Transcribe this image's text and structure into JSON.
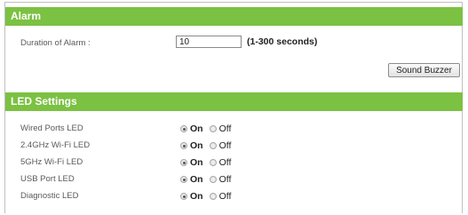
{
  "alarm": {
    "header": "Alarm",
    "duration_label": "Duration of Alarm :",
    "duration_value": "10",
    "duration_hint": "(1-300 seconds)",
    "sound_buzzer_label": "Sound Buzzer"
  },
  "led": {
    "header": "LED Settings",
    "on_label": "On",
    "off_label": "Off",
    "rows": [
      {
        "label": "Wired Ports LED",
        "selected": "On"
      },
      {
        "label": "2.4GHz Wi-Fi LED",
        "selected": "On"
      },
      {
        "label": "5GHz Wi-Fi LED",
        "selected": "On"
      },
      {
        "label": "USB Port LED",
        "selected": "On"
      },
      {
        "label": "Diagnostic LED",
        "selected": "On"
      }
    ]
  },
  "colors": {
    "header_green": "#7bc142"
  }
}
